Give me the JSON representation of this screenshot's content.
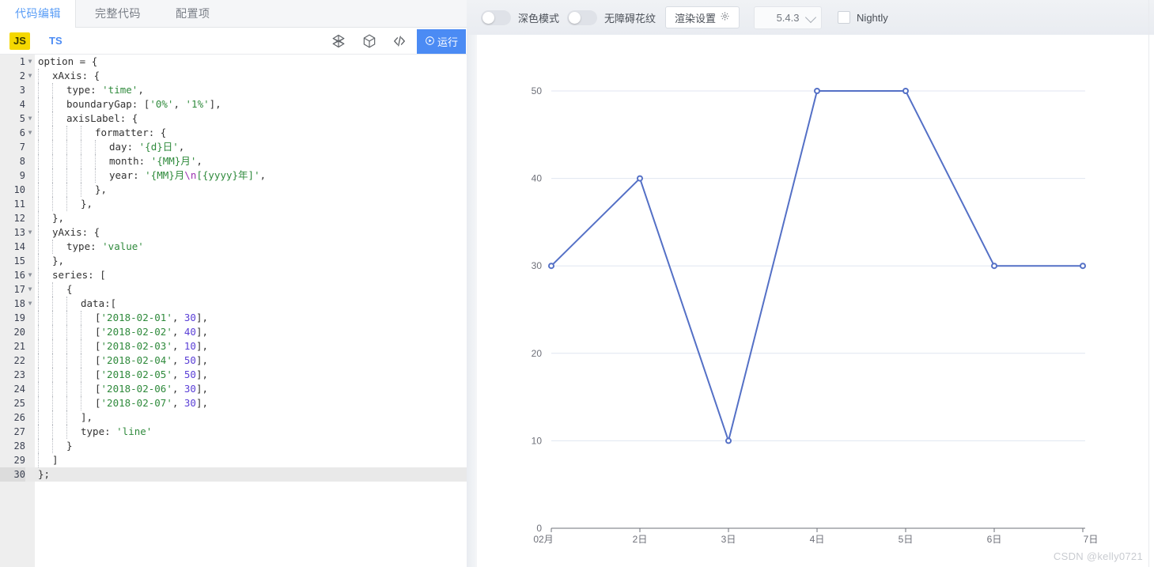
{
  "editor": {
    "tabs": [
      {
        "label": "代码编辑",
        "active": true
      },
      {
        "label": "完整代码",
        "active": false
      },
      {
        "label": "配置项",
        "active": false
      }
    ],
    "lang_js": "JS",
    "lang_ts": "TS",
    "icons": {
      "mesh": "mesh-3d-icon",
      "cube": "cube-icon",
      "code": "code-brackets-icon",
      "run": "play-circle-icon"
    },
    "run_label": "运行",
    "active_line": 30,
    "lines": [
      {
        "n": 1,
        "fold": true,
        "indent": 0,
        "text": "option = {"
      },
      {
        "n": 2,
        "fold": true,
        "indent": 1,
        "text": "xAxis: {"
      },
      {
        "n": 3,
        "fold": false,
        "indent": 2,
        "text": "type: 'time',"
      },
      {
        "n": 4,
        "fold": false,
        "indent": 2,
        "text": "boundaryGap: ['0%', '1%'],"
      },
      {
        "n": 5,
        "fold": true,
        "indent": 2,
        "text": "axisLabel: {"
      },
      {
        "n": 6,
        "fold": true,
        "indent": 4,
        "text": "formatter: {"
      },
      {
        "n": 7,
        "fold": false,
        "indent": 5,
        "text": "day: '{d}日',"
      },
      {
        "n": 8,
        "fold": false,
        "indent": 5,
        "text": "month: '{MM}月',"
      },
      {
        "n": 9,
        "fold": false,
        "indent": 5,
        "text": "year: '{MM}月\\n[{yyyy}年]',"
      },
      {
        "n": 10,
        "fold": false,
        "indent": 4,
        "text": "},"
      },
      {
        "n": 11,
        "fold": false,
        "indent": 3,
        "text": "},"
      },
      {
        "n": 12,
        "fold": false,
        "indent": 1,
        "text": "},"
      },
      {
        "n": 13,
        "fold": true,
        "indent": 1,
        "text": "yAxis: {"
      },
      {
        "n": 14,
        "fold": false,
        "indent": 2,
        "text": "type: 'value'"
      },
      {
        "n": 15,
        "fold": false,
        "indent": 1,
        "text": "},"
      },
      {
        "n": 16,
        "fold": true,
        "indent": 1,
        "text": "series: ["
      },
      {
        "n": 17,
        "fold": true,
        "indent": 2,
        "text": "{"
      },
      {
        "n": 18,
        "fold": true,
        "indent": 3,
        "text": "data:["
      },
      {
        "n": 19,
        "fold": false,
        "indent": 4,
        "text": "['2018-02-01', 30],"
      },
      {
        "n": 20,
        "fold": false,
        "indent": 4,
        "text": "['2018-02-02', 40],"
      },
      {
        "n": 21,
        "fold": false,
        "indent": 4,
        "text": "['2018-02-03', 10],"
      },
      {
        "n": 22,
        "fold": false,
        "indent": 4,
        "text": "['2018-02-04', 50],"
      },
      {
        "n": 23,
        "fold": false,
        "indent": 4,
        "text": "['2018-02-05', 50],"
      },
      {
        "n": 24,
        "fold": false,
        "indent": 4,
        "text": "['2018-02-06', 30],"
      },
      {
        "n": 25,
        "fold": false,
        "indent": 4,
        "text": "['2018-02-07', 30],"
      },
      {
        "n": 26,
        "fold": false,
        "indent": 3,
        "text": "],"
      },
      {
        "n": 27,
        "fold": false,
        "indent": 3,
        "text": "type: 'line'"
      },
      {
        "n": 28,
        "fold": false,
        "indent": 2,
        "text": "}"
      },
      {
        "n": 29,
        "fold": false,
        "indent": 1,
        "text": "]"
      },
      {
        "n": 30,
        "fold": false,
        "indent": 0,
        "text": "};"
      }
    ]
  },
  "toolbar": {
    "dark_mode_label": "深色模式",
    "dark_mode_on": false,
    "accessibility_label": "无障碍花纹",
    "accessibility_on": false,
    "render_settings_label": "渲染设置",
    "render_settings_icon": "gear-icon",
    "version": "5.4.3",
    "version_chevron": "chevron-down-icon",
    "nightly_label": "Nightly",
    "nightly_checked": false
  },
  "watermark": "CSDN @kelly0721",
  "colors": {
    "accent": "#4b8bf4",
    "series": "#5470c6",
    "grid": "#e0e6f1",
    "axis_text": "#6e7079",
    "js_badge": "#f5d800"
  },
  "chart_data": {
    "type": "line",
    "title": "",
    "xlabel": "",
    "ylabel": "",
    "x_axis_type": "time",
    "y_axis_type": "value",
    "boundary_gap": [
      "0%",
      "1%"
    ],
    "x": [
      "2018-02-01",
      "2018-02-02",
      "2018-02-03",
      "2018-02-04",
      "2018-02-05",
      "2018-02-06",
      "2018-02-07"
    ],
    "values": [
      30,
      40,
      10,
      50,
      50,
      30,
      30
    ],
    "xtick_labels": [
      "02月",
      "2日",
      "3日",
      "4日",
      "5日",
      "6日",
      "7日"
    ],
    "ytick_labels": [
      "0",
      "10",
      "20",
      "30",
      "40",
      "50"
    ],
    "ytick_values": [
      0,
      10,
      20,
      30,
      40,
      50
    ],
    "ylim": [
      0,
      55
    ],
    "grid": true,
    "legend": "none",
    "show_symbols": true,
    "line_color": "#5470c6"
  }
}
